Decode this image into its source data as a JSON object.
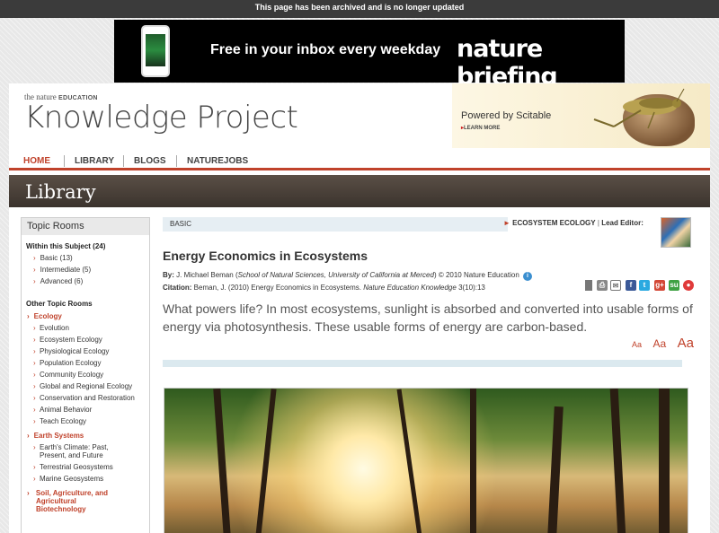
{
  "archive_notice": "This page has been archived and is no longer updated",
  "banner": {
    "tagline": "Free in your inbox every weekday",
    "brand": "nature briefing"
  },
  "header": {
    "nature_prefix": "the",
    "nature_word": "nature",
    "education_word": "EDUCATION",
    "site_title": "Knowledge Project",
    "powered_by": "Powered by Scitable",
    "learn_more": "LEARN MORE"
  },
  "nav": {
    "items": [
      "HOME",
      "LIBRARY",
      "BLOGS",
      "NATUREJOBS"
    ],
    "active": "HOME"
  },
  "section_title": "Library",
  "sidebar": {
    "title": "Topic Rooms",
    "within_subject": "Within this Subject (24)",
    "levels": [
      "Basic (13)",
      "Intermediate (5)",
      "Advanced (6)"
    ],
    "other_title": "Other Topic Rooms",
    "ecology": {
      "label": "Ecology",
      "items": [
        "Evolution",
        "Ecosystem Ecology",
        "Physiological Ecology",
        "Population Ecology",
        "Community Ecology",
        "Global and Regional Ecology",
        "Conservation and Restoration",
        "Animal Behavior",
        "Teach Ecology"
      ]
    },
    "earth": {
      "label": "Earth Systems",
      "items": [
        "Earth's Climate: Past,",
        "Present, and Future",
        "Terrestrial Geosystems",
        "Marine Geosystems"
      ]
    },
    "soil": {
      "label_1": "Soil, Agriculture, and",
      "label_2": "Agricultural",
      "label_3": "Biotechnology"
    }
  },
  "article": {
    "level": "BASIC",
    "topic": "ECOSYSTEM ECOLOGY",
    "lead_editor_label": "Lead Editor:",
    "title": "Energy Economics in Ecosystems",
    "by_label": "By:",
    "author": "J. Michael Beman",
    "affiliation": "School of Natural Sciences, University of California at Merced",
    "copyright": "© 2010 Nature Education",
    "citation_label": "Citation:",
    "citation_text": "Beman, J. (2010) Energy Economics in Ecosystems.",
    "journal": "Nature Education Knowledge",
    "volume": "3(10):13",
    "abstract": "What powers life? In most ecosystems, sunlight is absorbed and converted into usable forms of energy via photosynthesis. These usable forms of energy are carbon-based.",
    "font_small": "Aa",
    "font_medium": "Aa",
    "font_large": "Aa"
  },
  "share_icons": [
    "bookmark-icon",
    "print-icon",
    "email-icon",
    "facebook-icon",
    "twitter-icon",
    "google-plus-icon",
    "stumbleupon-icon",
    "reddit-icon"
  ],
  "colors": {
    "accent": "#c0422b",
    "library_bar": "#4a413a",
    "level_tab": "#e6eef3"
  }
}
